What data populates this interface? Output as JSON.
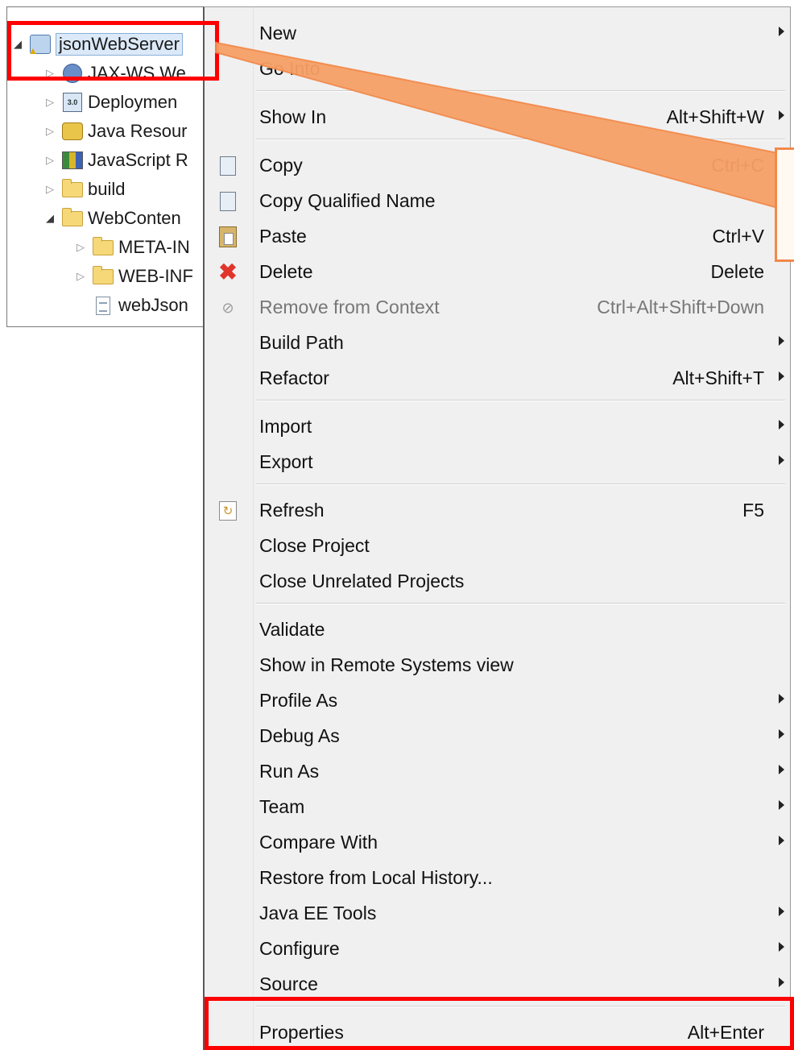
{
  "explorer": {
    "rows": [
      {
        "label": "jsonWebServer",
        "twisty": "open"
      },
      {
        "label": "JAX-WS We",
        "twisty": "closed"
      },
      {
        "label": "Deploymen",
        "twisty": "closed"
      },
      {
        "label": "Java Resour",
        "twisty": "closed"
      },
      {
        "label": "JavaScript R",
        "twisty": "closed"
      },
      {
        "label": "build",
        "twisty": "closed"
      },
      {
        "label": "WebConten",
        "twisty": "open"
      },
      {
        "label": "META-IN",
        "twisty": "closed"
      },
      {
        "label": "WEB-INF",
        "twisty": "closed"
      },
      {
        "label": "webJson",
        "twisty": "none"
      }
    ],
    "badge_3_0": "3.0"
  },
  "menu": {
    "new": {
      "label": "New"
    },
    "go_into": {
      "label": "Go Into"
    },
    "show_in": {
      "label": "Show In",
      "accel": "Alt+Shift+W"
    },
    "copy": {
      "label": "Copy",
      "accel": "Ctrl+C"
    },
    "copy_qualified": {
      "label": "Copy Qualified Name"
    },
    "paste": {
      "label": "Paste",
      "accel": "Ctrl+V"
    },
    "delete": {
      "label": "Delete",
      "accel": "Delete"
    },
    "remove_context": {
      "label": "Remove from Context",
      "accel": "Ctrl+Alt+Shift+Down"
    },
    "build_path": {
      "label": "Build Path"
    },
    "refactor": {
      "label": "Refactor",
      "accel": "Alt+Shift+T"
    },
    "import": {
      "label": "Import"
    },
    "export": {
      "label": "Export"
    },
    "refresh": {
      "label": "Refresh",
      "accel": "F5"
    },
    "close_project": {
      "label": "Close Project"
    },
    "close_unrelated": {
      "label": "Close Unrelated Projects"
    },
    "validate": {
      "label": "Validate"
    },
    "show_remote": {
      "label": "Show in Remote Systems view"
    },
    "profile_as": {
      "label": "Profile As"
    },
    "debug_as": {
      "label": "Debug As"
    },
    "run_as": {
      "label": "Run As"
    },
    "team": {
      "label": "Team"
    },
    "compare_with": {
      "label": "Compare With"
    },
    "restore_history": {
      "label": "Restore from Local History..."
    },
    "java_ee_tools": {
      "label": "Java EE Tools"
    },
    "configure": {
      "label": "Configure"
    },
    "source": {
      "label": "Source"
    },
    "properties": {
      "label": "Properties",
      "accel": "Alt+Enter"
    }
  },
  "colors": {
    "highlight": "#ff0000",
    "arrow": "#f2894a",
    "menu_bg": "#f0f0f0"
  }
}
